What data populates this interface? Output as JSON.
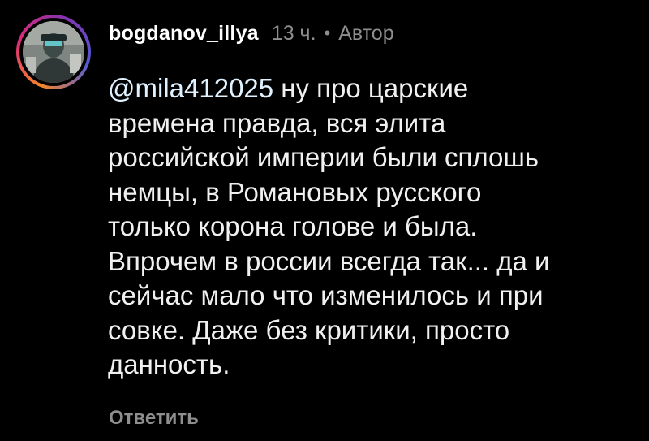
{
  "comment": {
    "username": "bogdanov_illya",
    "time": "13 ч.",
    "separator": "•",
    "author_badge": "Автор",
    "mention": "@mila412025",
    "text_after_mention": " ну про царские\nвремена правда, вся элита\nроссийской империи были сплошь\nнемцы, в Романовых русского\nтолько корона голове и была.\nВпрочем в россии всегда так... да и\nсейчас мало что изменилось и при\nсовке. Даже без критики, просто\nданность.",
    "reply_label": "Ответить",
    "avatar_icon": "user-avatar-photo"
  },
  "colors": {
    "background": "#000000",
    "username": "#ffffff",
    "meta": "#8e8e8e",
    "text": "#f0f0f0"
  }
}
